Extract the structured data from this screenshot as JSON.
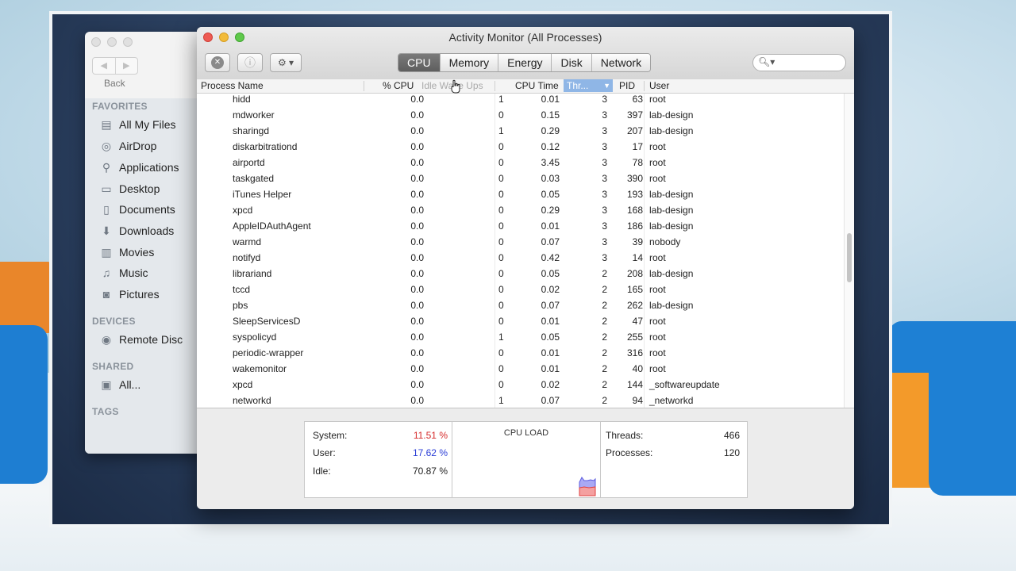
{
  "finder": {
    "back_label": "Back",
    "nav_back": "◀",
    "nav_forward": "▶",
    "sections": {
      "favorites": "FAVORITES",
      "devices": "DEVICES",
      "shared": "SHARED",
      "tags": "TAGS"
    },
    "favorites": [
      {
        "label": "All My Files",
        "icon": "all-files-icon",
        "glyph": "▤"
      },
      {
        "label": "AirDrop",
        "icon": "airdrop-icon",
        "glyph": "◎"
      },
      {
        "label": "Applications",
        "icon": "applications-icon",
        "glyph": "⚲"
      },
      {
        "label": "Desktop",
        "icon": "desktop-icon",
        "glyph": "▭"
      },
      {
        "label": "Documents",
        "icon": "documents-icon",
        "glyph": "▯"
      },
      {
        "label": "Downloads",
        "icon": "downloads-icon",
        "glyph": "⬇"
      },
      {
        "label": "Movies",
        "icon": "movies-icon",
        "glyph": "▥"
      },
      {
        "label": "Music",
        "icon": "music-icon",
        "glyph": "♫"
      },
      {
        "label": "Pictures",
        "icon": "pictures-icon",
        "glyph": "◙"
      }
    ],
    "devices": [
      {
        "label": "Remote Disc",
        "icon": "disc-icon",
        "glyph": "◉"
      }
    ],
    "shared": [
      {
        "label": "All...",
        "icon": "network-icon",
        "glyph": "▣"
      }
    ]
  },
  "activity_monitor": {
    "title": "Activity Monitor (All Processes)",
    "toolbar": {
      "stop_icon": "✕",
      "info_icon": "ⓘ",
      "gear_icon": "⚙ ▾",
      "search_icon": "🔍︎▾"
    },
    "tabs": [
      {
        "label": "CPU",
        "active": true
      },
      {
        "label": "Memory",
        "active": false
      },
      {
        "label": "Energy",
        "active": false
      },
      {
        "label": "Disk",
        "active": false
      },
      {
        "label": "Network",
        "active": false
      }
    ],
    "columns": {
      "name": "Process Name",
      "cpu": "% CPU",
      "idle": "Idle Wake Ups",
      "time": "CPU Time",
      "threads": "Thr...",
      "sort_arrow": "▼",
      "pid": "PID",
      "user": "User"
    },
    "rows": [
      {
        "name": "hidd",
        "cpu": "0.0",
        "idle": "1",
        "time": "0.01",
        "threads": "3",
        "pid": "63",
        "user": "root"
      },
      {
        "name": "mdworker",
        "cpu": "0.0",
        "idle": "0",
        "time": "0.15",
        "threads": "3",
        "pid": "397",
        "user": "lab-design"
      },
      {
        "name": "sharingd",
        "cpu": "0.0",
        "idle": "1",
        "time": "0.29",
        "threads": "3",
        "pid": "207",
        "user": "lab-design"
      },
      {
        "name": "diskarbitrationd",
        "cpu": "0.0",
        "idle": "0",
        "time": "0.12",
        "threads": "3",
        "pid": "17",
        "user": "root"
      },
      {
        "name": "airportd",
        "cpu": "0.0",
        "idle": "0",
        "time": "3.45",
        "threads": "3",
        "pid": "78",
        "user": "root"
      },
      {
        "name": "taskgated",
        "cpu": "0.0",
        "idle": "0",
        "time": "0.03",
        "threads": "3",
        "pid": "390",
        "user": "root"
      },
      {
        "name": "iTunes Helper",
        "cpu": "0.0",
        "idle": "0",
        "time": "0.05",
        "threads": "3",
        "pid": "193",
        "user": "lab-design"
      },
      {
        "name": "xpcd",
        "cpu": "0.0",
        "idle": "0",
        "time": "0.29",
        "threads": "3",
        "pid": "168",
        "user": "lab-design"
      },
      {
        "name": "AppleIDAuthAgent",
        "cpu": "0.0",
        "idle": "0",
        "time": "0.01",
        "threads": "3",
        "pid": "186",
        "user": "lab-design"
      },
      {
        "name": "warmd",
        "cpu": "0.0",
        "idle": "0",
        "time": "0.07",
        "threads": "3",
        "pid": "39",
        "user": "nobody"
      },
      {
        "name": "notifyd",
        "cpu": "0.0",
        "idle": "0",
        "time": "0.42",
        "threads": "3",
        "pid": "14",
        "user": "root"
      },
      {
        "name": "librariand",
        "cpu": "0.0",
        "idle": "0",
        "time": "0.05",
        "threads": "2",
        "pid": "208",
        "user": "lab-design"
      },
      {
        "name": "tccd",
        "cpu": "0.0",
        "idle": "0",
        "time": "0.02",
        "threads": "2",
        "pid": "165",
        "user": "root"
      },
      {
        "name": "pbs",
        "cpu": "0.0",
        "idle": "0",
        "time": "0.07",
        "threads": "2",
        "pid": "262",
        "user": "lab-design"
      },
      {
        "name": "SleepServicesD",
        "cpu": "0.0",
        "idle": "0",
        "time": "0.01",
        "threads": "2",
        "pid": "47",
        "user": "root"
      },
      {
        "name": "syspolicyd",
        "cpu": "0.0",
        "idle": "1",
        "time": "0.05",
        "threads": "2",
        "pid": "255",
        "user": "root"
      },
      {
        "name": "periodic-wrapper",
        "cpu": "0.0",
        "idle": "0",
        "time": "0.01",
        "threads": "2",
        "pid": "316",
        "user": "root"
      },
      {
        "name": "wakemonitor",
        "cpu": "0.0",
        "idle": "0",
        "time": "0.01",
        "threads": "2",
        "pid": "40",
        "user": "root"
      },
      {
        "name": "xpcd",
        "cpu": "0.0",
        "idle": "0",
        "time": "0.02",
        "threads": "2",
        "pid": "144",
        "user": "_softwareupdate"
      },
      {
        "name": "networkd",
        "cpu": "0.0",
        "idle": "1",
        "time": "0.07",
        "threads": "2",
        "pid": "94",
        "user": "_networkd"
      }
    ],
    "summary": {
      "system_label": "System:",
      "system_value": "11.51 %",
      "user_label": "User:",
      "user_value": "17.62 %",
      "idle_label": "Idle:",
      "idle_value": "70.87 %",
      "cpu_load_title": "CPU LOAD",
      "threads_label": "Threads:",
      "threads_value": "466",
      "processes_label": "Processes:",
      "processes_value": "120"
    },
    "colors": {
      "system": "#d62b2b",
      "user": "#2b3ed6",
      "sorted_header": "#8fb6e6",
      "active_tab": "#6a6a6a"
    }
  }
}
